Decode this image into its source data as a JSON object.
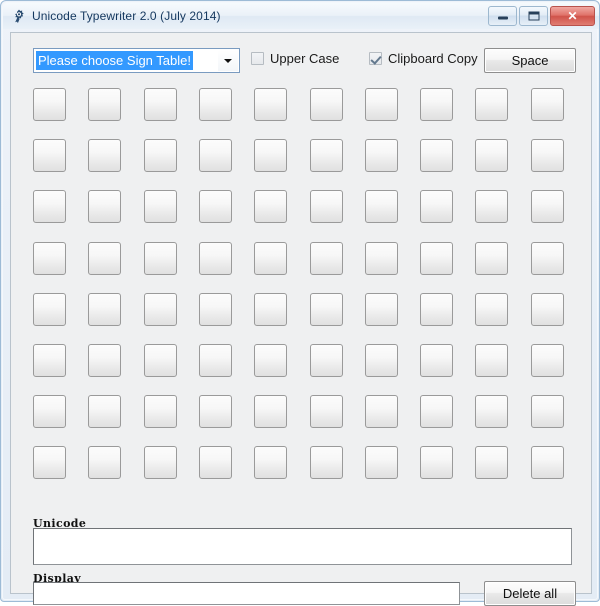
{
  "window": {
    "title": "Unicode Typewriter 2.0 (July 2014)",
    "icon": "app-gear-icon",
    "controls": {
      "minimize_label": "–",
      "maximize_label": "❐",
      "close_label": "✕"
    },
    "frame_color": "#9dbbd6",
    "client_background": "#eff0f1"
  },
  "toolbar": {
    "sign_table_combo": {
      "selected_value": "Please choose Sign Table!",
      "selection_highlight_color": "#3399ff",
      "arrow_icon": "chevron-down-icon"
    },
    "upper_case": {
      "label": "Upper Case",
      "checked": false
    },
    "clipboard_copy": {
      "label": "Clipboard Copy",
      "checked": true
    },
    "space_button_label": "Space"
  },
  "grid": {
    "columns": 10,
    "rows": 8,
    "cells": [
      "",
      "",
      "",
      "",
      "",
      "",
      "",
      "",
      "",
      "",
      "",
      "",
      "",
      "",
      "",
      "",
      "",
      "",
      "",
      "",
      "",
      "",
      "",
      "",
      "",
      "",
      "",
      "",
      "",
      "",
      "",
      "",
      "",
      "",
      "",
      "",
      "",
      "",
      "",
      "",
      "",
      "",
      "",
      "",
      "",
      "",
      "",
      "",
      "",
      "",
      "",
      "",
      "",
      "",
      "",
      "",
      "",
      "",
      "",
      "",
      "",
      "",
      "",
      "",
      "",
      "",
      "",
      "",
      "",
      "",
      "",
      "",
      "",
      "",
      "",
      "",
      "",
      "",
      "",
      ""
    ]
  },
  "fields": {
    "unicode": {
      "label": "Unicode",
      "value": "",
      "placeholder": ""
    },
    "display": {
      "label": "Display",
      "value": "",
      "placeholder": ""
    }
  },
  "actions": {
    "delete_all_label": "Delete all"
  }
}
